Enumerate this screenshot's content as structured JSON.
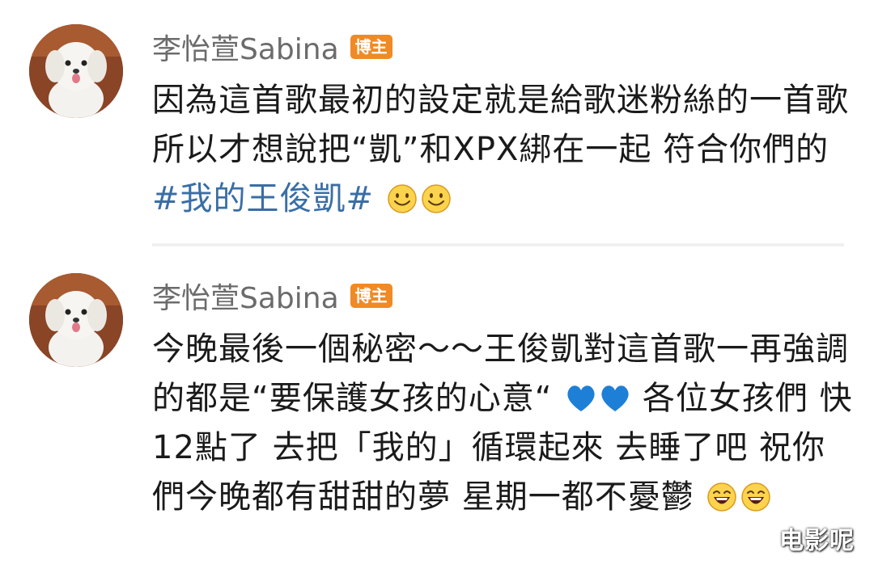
{
  "posts": [
    {
      "username": "李怡萱Sabina",
      "badge": "博主",
      "text_a": "因為這首歌最初的設定就是給歌迷粉絲的一首歌 所以才想說把“凱”和XPX綁在一起 符合你們的",
      "hashtag": "#我的王俊凱#",
      "emojis": [
        "smile-emoji",
        "smile-emoji"
      ]
    },
    {
      "username": "李怡萱Sabina",
      "badge": "博主",
      "text_a": "今晚最後一個秘密～～王俊凱對這首歌一再強調的都是“要保護女孩的心意“",
      "text_b": " 各位女孩們 快12點了 去把「我的」循環起來 去睡了吧 祝你們今晚都有甜甜的夢 星期一都不憂鬱",
      "emojis_mid": [
        "blue-heart-emoji",
        "blue-heart-emoji"
      ],
      "emojis_end": [
        "laughing-emoji",
        "laughing-emoji"
      ]
    }
  ],
  "watermark": "电影呢",
  "colors": {
    "badge": "#f08a24",
    "hashtag": "#3a6ea5",
    "username": "#6b6b6b",
    "text": "#1a1a1a"
  }
}
